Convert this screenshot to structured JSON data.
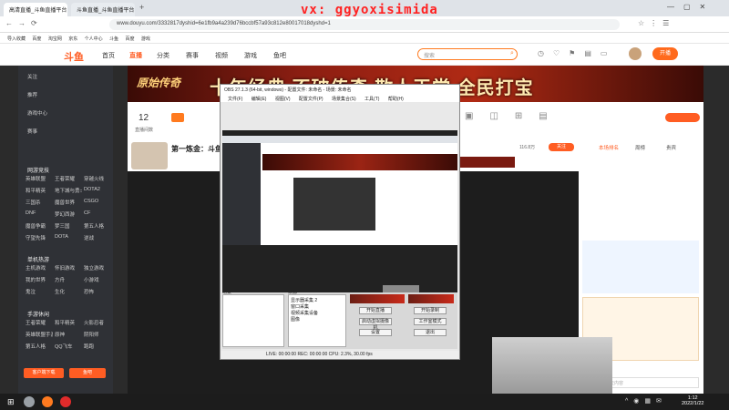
{
  "browser": {
    "tabs": [
      "高清直播_斗鱼直播平台",
      "斗鱼直播_斗鱼直播平台"
    ],
    "url": "www.douyu.com/3332817dyshid=6e1fb9a4a239d76bccbf57a93c812e80017018dyshd=1",
    "bookmarks": [
      "导入收藏",
      "百度",
      "淘宝网",
      "京东",
      "个人中心",
      "斗鱼",
      "百度",
      "游戏"
    ]
  },
  "watermark": "vx: ggyoxisimida",
  "site": {
    "logo": "斗鱼",
    "nav": [
      "首页",
      "直播",
      "分类",
      "赛事",
      "视频",
      "游戏",
      "鱼吧"
    ],
    "search_placeholder": "搜索",
    "open_button": "开播"
  },
  "sidebar": {
    "items": [
      "关注",
      "推荐",
      "游戏中心",
      "赛事"
    ],
    "sections": [
      {
        "title": "网游竞技",
        "items": [
          "英雄联盟",
          "王者荣耀",
          "穿越火线",
          "和平精英",
          "地下城与勇士",
          "DOTA2",
          "三国杀",
          "魔兽世界",
          "CSGO",
          "DNF",
          "梦幻西游",
          "CF",
          "魔兽争霸",
          "梦三国",
          "第五人格",
          "守望先锋",
          "DOTA",
          "逆战"
        ]
      },
      {
        "title": "单机热游",
        "items": [
          "主机游戏",
          "怀旧游戏",
          "独立游戏",
          "我的世界",
          "方舟",
          "小游戏",
          "鬼泣",
          "生化",
          "恐怖"
        ]
      },
      {
        "title": "手游休闲",
        "items": [
          "王者荣耀",
          "和平精英",
          "火影忍者",
          "英雄联盟手游",
          "原神",
          "阴阳师",
          "第五人格",
          "QQ飞车",
          "跑跑"
        ]
      }
    ],
    "footer": [
      "客户端下载",
      "鱼吧"
    ]
  },
  "banner": {
    "logo": "原始传奇",
    "text": "十年经典 不破传奇  散人天堂 全民打宝"
  },
  "stats": {
    "count": "12",
    "label": "直播间数"
  },
  "streamer": {
    "title": "第一炼金：斗鱼",
    "follow": "关注",
    "fans": "116.8万"
  },
  "chat_rank_tabs": [
    "本场排名",
    "周榜",
    "贵宾"
  ],
  "chat_placeholder": "这里输入聊天内容",
  "obs": {
    "title": "OBS 27.1.3 (64-bit, windows) - 配置文件: 未命名 - 场景: 未命名",
    "menu": [
      "文件(F)",
      "编辑(E)",
      "视图(V)",
      "配置文件(P)",
      "场景集合(S)",
      "工具(T)",
      "帮助(H)"
    ],
    "scenes_label": "场景",
    "sources_label": "来源",
    "sources": [
      "显示器采集 2",
      "窗口采集",
      "视频采集设备",
      "图像"
    ],
    "buttons": [
      "开始直播",
      "开始录制",
      "启动虚拟摄像机",
      "工作室模式",
      "设置",
      "退出"
    ],
    "status": "LIVE: 00:00:00   REC: 00:00:00   CPU: 2.3%, 30.00 fps"
  },
  "taskbar": {
    "time": "1:12",
    "date": "2022/1/22"
  }
}
